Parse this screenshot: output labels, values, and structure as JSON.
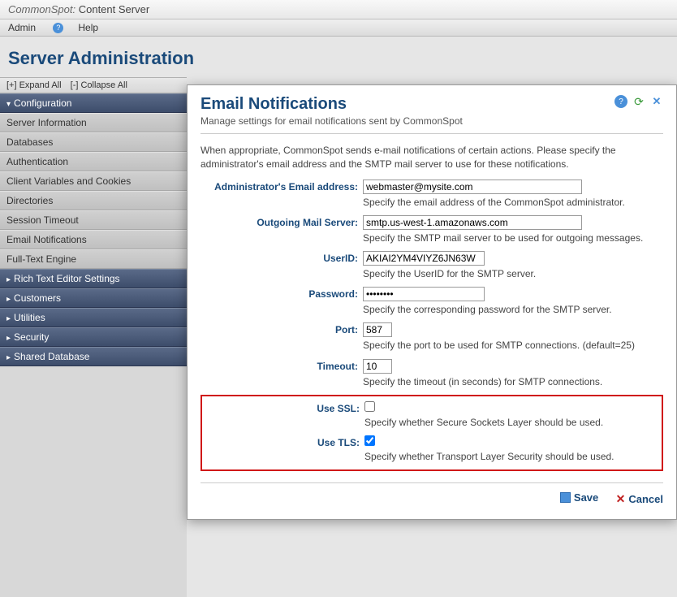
{
  "header": {
    "brand_html": "CommonSpot: Content Server",
    "brand_left": "CommonSpot:",
    "brand_right": "Content Server"
  },
  "menubar": {
    "admin": "Admin",
    "help": "Help"
  },
  "page_title": "Server Administration",
  "expand": {
    "expand_all": "[+] Expand All",
    "collapse_all": "[-] Collapse All"
  },
  "nav": {
    "sections": [
      {
        "label": "Configuration",
        "type": "section",
        "expanded": true
      },
      {
        "label": "Server Information",
        "type": "item"
      },
      {
        "label": "Databases",
        "type": "item"
      },
      {
        "label": "Authentication",
        "type": "item"
      },
      {
        "label": "Client Variables and Cookies",
        "type": "item"
      },
      {
        "label": "Directories",
        "type": "item"
      },
      {
        "label": "Session Timeout",
        "type": "item"
      },
      {
        "label": "Email Notifications",
        "type": "item"
      },
      {
        "label": "Full-Text Engine",
        "type": "item"
      },
      {
        "label": "Rich Text Editor Settings",
        "type": "section"
      },
      {
        "label": "Customers",
        "type": "section"
      },
      {
        "label": "Utilities",
        "type": "section"
      },
      {
        "label": "Security",
        "type": "section"
      },
      {
        "label": "Shared Database",
        "type": "section"
      }
    ]
  },
  "dialog": {
    "title": "Email Notifications",
    "subtitle": "Manage settings for email notifications sent by CommonSpot",
    "intro": "When appropriate, CommonSpot sends e-mail notifications of certain actions. Please specify the administrator's email address and the SMTP mail server to use for these notifications.",
    "fields": {
      "admin_email": {
        "label": "Administrator's Email address:",
        "value": "webmaster@mysite.com",
        "hint": "Specify the email address of the CommonSpot administrator."
      },
      "mail_server": {
        "label": "Outgoing Mail Server:",
        "value": "smtp.us-west-1.amazonaws.com",
        "hint": "Specify the SMTP mail server to be used for outgoing messages."
      },
      "userid": {
        "label": "UserID:",
        "value": "AKIAI2YM4VIYZ6JN63W",
        "hint": "Specify the UserID for the SMTP server."
      },
      "password": {
        "label": "Password:",
        "value": "••••••••",
        "hint": "Specify the corresponding password for the SMTP server."
      },
      "port": {
        "label": "Port:",
        "value": "587",
        "hint": "Specify the port to be used for SMTP connections. (default=25)"
      },
      "timeout": {
        "label": "Timeout:",
        "value": "10",
        "hint": "Specify the timeout (in seconds) for SMTP connections."
      },
      "use_ssl": {
        "label": "Use SSL:",
        "checked": false,
        "hint": "Specify whether Secure Sockets Layer should be used."
      },
      "use_tls": {
        "label": "Use TLS:",
        "checked": true,
        "hint": "Specify whether Transport Layer Security should be used."
      }
    },
    "buttons": {
      "save": "Save",
      "cancel": "Cancel"
    }
  }
}
